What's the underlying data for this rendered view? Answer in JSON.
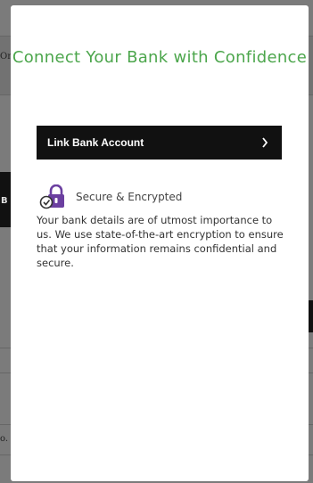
{
  "background": {
    "fragments": [
      "On",
      "B",
      "o."
    ]
  },
  "modal": {
    "title": "Connect Your Bank with Confidence",
    "link_button_label": "Link Bank Account",
    "link_button_icon": "chevron-right-icon",
    "secure_icon": "lock-check-icon",
    "secure_label": "Secure & Encrypted",
    "description": "Your bank details are of utmost importance to us. We use state-of-the-art encryption to ensure that your information remains confidential and secure."
  },
  "colors": {
    "title": "#4ca64c",
    "button_bg": "#111111",
    "icon_accent": "#6b3fa0"
  }
}
